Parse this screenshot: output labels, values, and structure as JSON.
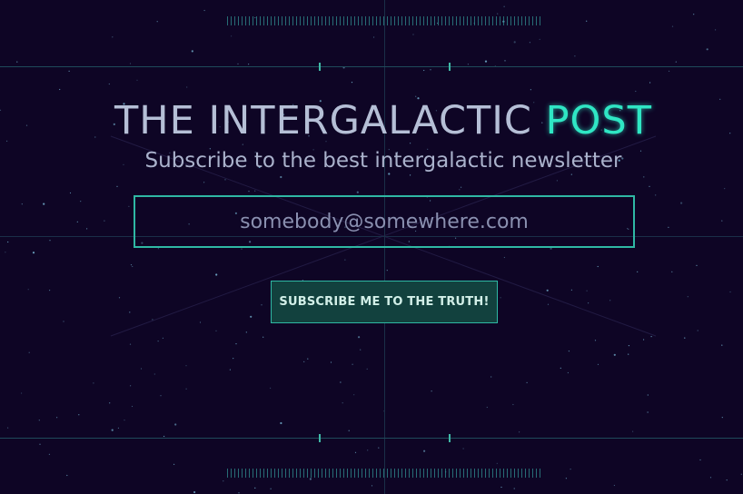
{
  "header": {
    "title_main": "THE INTERGALACTIC ",
    "title_accent": "POST",
    "subtitle": "Subscribe to the best intergalactic newsletter"
  },
  "form": {
    "email_placeholder": "somebody@somewhere.com",
    "email_value": "",
    "submit_label": "SUBSCRIBE ME TO THE TRUTH!"
  },
  "colors": {
    "background": "#0e0525",
    "accent": "#2fe6c4",
    "border": "#2fb8a4",
    "text": "#b5bfd6",
    "button_bg": "#12413e"
  }
}
